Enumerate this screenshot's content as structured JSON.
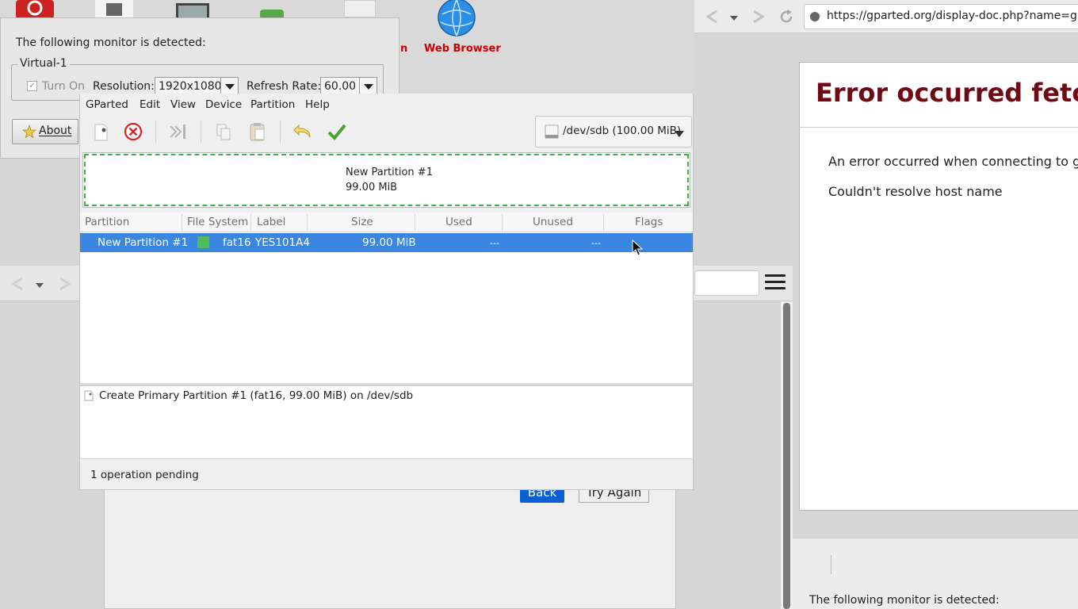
{
  "desktop": {
    "web_browser_label": "Web Browser",
    "partial_label": "n"
  },
  "monitor_dialog": {
    "detected_text": "The following monitor is detected:",
    "group_label": "Virtual-1",
    "turn_on_label": "Turn On",
    "turn_on_checked": true,
    "resolution_label": "Resolution:",
    "resolution_value": "1920x1080",
    "refresh_label": "Refresh Rate:",
    "refresh_value": "60.00",
    "about_label": "About"
  },
  "browser_right": {
    "url": "https://gparted.org/display-doc.php?name=gparted",
    "error_title": "Error occurred fetchi",
    "error_line1": "An error occurred when connecting to gp",
    "error_line2": "Couldn't resolve host name",
    "bottom_monitor_text": "The following monitor is detected:"
  },
  "browser_mid": {
    "back_label": "Back",
    "try_again_label": "Try Again"
  },
  "gparted": {
    "menu": [
      "GParted",
      "Edit",
      "View",
      "Device",
      "Partition",
      "Help"
    ],
    "device": "/dev/sdb (100.00 MiB)",
    "graphic": {
      "name": "New Partition #1",
      "size": "99.00 MiB",
      "fs_color": "#4dbc5a"
    },
    "columns": [
      "Partition",
      "File System",
      "Label",
      "Size",
      "Used",
      "Unused",
      "Flags"
    ],
    "rows": [
      {
        "partition": "New Partition #1",
        "file_system": "fat16",
        "label": "YES101A4",
        "size": "99.00 MiB",
        "used": "---",
        "unused": "---",
        "flags": ""
      }
    ],
    "operations": [
      "Create Primary Partition #1 (fat16, 99.00 MiB) on /dev/sdb"
    ],
    "status": "1 operation pending"
  },
  "colors": {
    "selection": "#3a86e0",
    "error_title": "#6f0a14",
    "desktop_label": "#cc0000",
    "partition_border": "#3bb54a"
  }
}
